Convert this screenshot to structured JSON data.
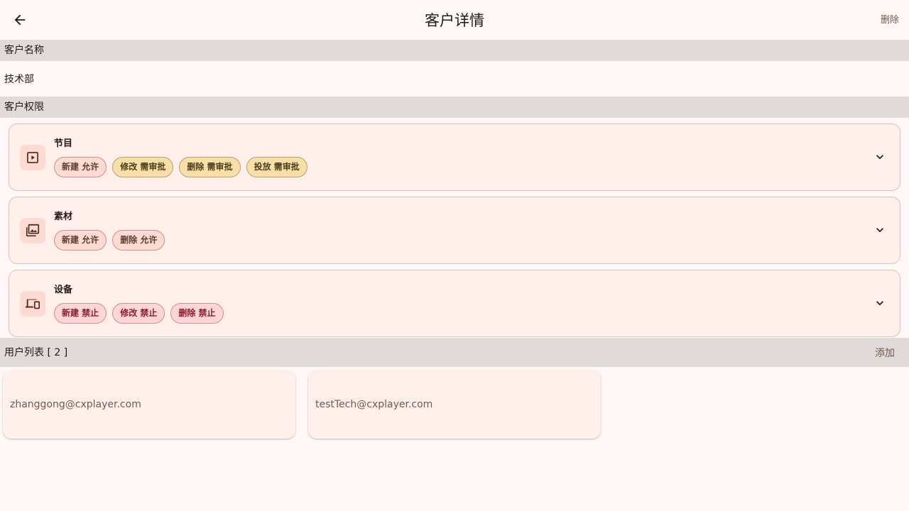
{
  "header": {
    "title": "客户详情",
    "delete_label": "删除"
  },
  "customer": {
    "name_label": "客户名称",
    "name_value": "技术部",
    "permissions_label": "客户权限"
  },
  "permissions": [
    {
      "title": "节目",
      "icon": "play-box-icon",
      "chips": [
        {
          "text": "新建 允许",
          "status": "allow"
        },
        {
          "text": "修改 需审批",
          "status": "review"
        },
        {
          "text": "删除 需审批",
          "status": "review"
        },
        {
          "text": "投放 需审批",
          "status": "review"
        }
      ]
    },
    {
      "title": "素材",
      "icon": "image-library-icon",
      "chips": [
        {
          "text": "新建 允许",
          "status": "allow"
        },
        {
          "text": "删除 允许",
          "status": "allow"
        }
      ]
    },
    {
      "title": "设备",
      "icon": "devices-icon",
      "chips": [
        {
          "text": "新建 禁止",
          "status": "deny"
        },
        {
          "text": "修改 禁止",
          "status": "deny"
        },
        {
          "text": "删除 禁止",
          "status": "deny"
        }
      ]
    }
  ],
  "users": {
    "title": "用户列表 [ 2 ]",
    "add_label": "添加",
    "items": [
      {
        "email": "zhanggong@cxplayer.com"
      },
      {
        "email": "testTech@cxplayer.com"
      }
    ]
  },
  "colors": {
    "background": "#fff8f6",
    "section": "#e0dad8",
    "card": "#fff0ec",
    "accent": "#77574e"
  }
}
